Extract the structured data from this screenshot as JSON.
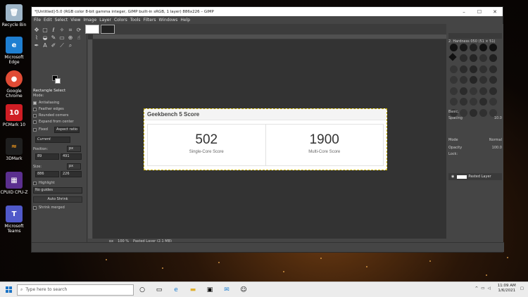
{
  "desktop": {
    "icons": [
      {
        "label": "Recycle Bin",
        "color": "#9fb6c8"
      },
      {
        "label": "Microsoft Edge",
        "color": "#1f7fd1"
      },
      {
        "label": "Google Chrome",
        "color": "#e04b35"
      },
      {
        "label": "PCMark 10",
        "color": "#cf1d24"
      },
      {
        "label": "3DMark",
        "color": "#1f1f1f"
      },
      {
        "label": "CPUID CPU-Z",
        "color": "#5b2f8f"
      },
      {
        "label": "Microsoft Teams",
        "color": "#5059c9"
      }
    ]
  },
  "gimp": {
    "title": "*[Untitled]-5.0 (RGB color 8-bit gamma integer, GIMP built-in sRGB, 1 layer) 886x226 – GIMP",
    "menu": [
      "File",
      "Edit",
      "Select",
      "View",
      "Image",
      "Layer",
      "Colors",
      "Tools",
      "Filters",
      "Windows",
      "Help"
    ],
    "tool_options": {
      "title": "Rectangle Select",
      "mode_label": "Mode:",
      "antialiasing": "Antialiasing",
      "feather": "Feather edges",
      "rounded": "Rounded corners",
      "expand": "Expand from center",
      "fixed": "Fixed",
      "aspect": "Aspect ratio",
      "current": "Current",
      "position_label": "Position:",
      "unit": "px",
      "pos_x": "89",
      "pos_y": "491",
      "size_label": "Size:",
      "size_w": "886",
      "size_h": "226",
      "highlight": "Highlight",
      "guides": "No guides",
      "auto_shrink": "Auto Shrink",
      "shrink_merged": "Shrink merged"
    },
    "status": {
      "unit": "px",
      "zoom": "100 %",
      "layer": "Pasted Layer (2.1 MB)"
    },
    "image": {
      "title": "Geekbench 5 Score",
      "single_value": "502",
      "single_label": "Single-Core Score",
      "multi_value": "1900",
      "multi_label": "Multi-Core Score"
    },
    "dock": {
      "brush_name": "2. Hardness 050 (51 × 51)",
      "basic": "Basic,",
      "spacing_label": "Spacing",
      "spacing_value": "10.0",
      "mode_label": "Mode",
      "mode_value": "Normal",
      "opacity_label": "Opacity",
      "opacity_value": "100.0",
      "lock_label": "Lock:",
      "layer_name": "Pasted Layer"
    }
  },
  "taskbar": {
    "search_placeholder": "Type here to search",
    "time": "11:09 AM",
    "date": "1/6/2021"
  }
}
